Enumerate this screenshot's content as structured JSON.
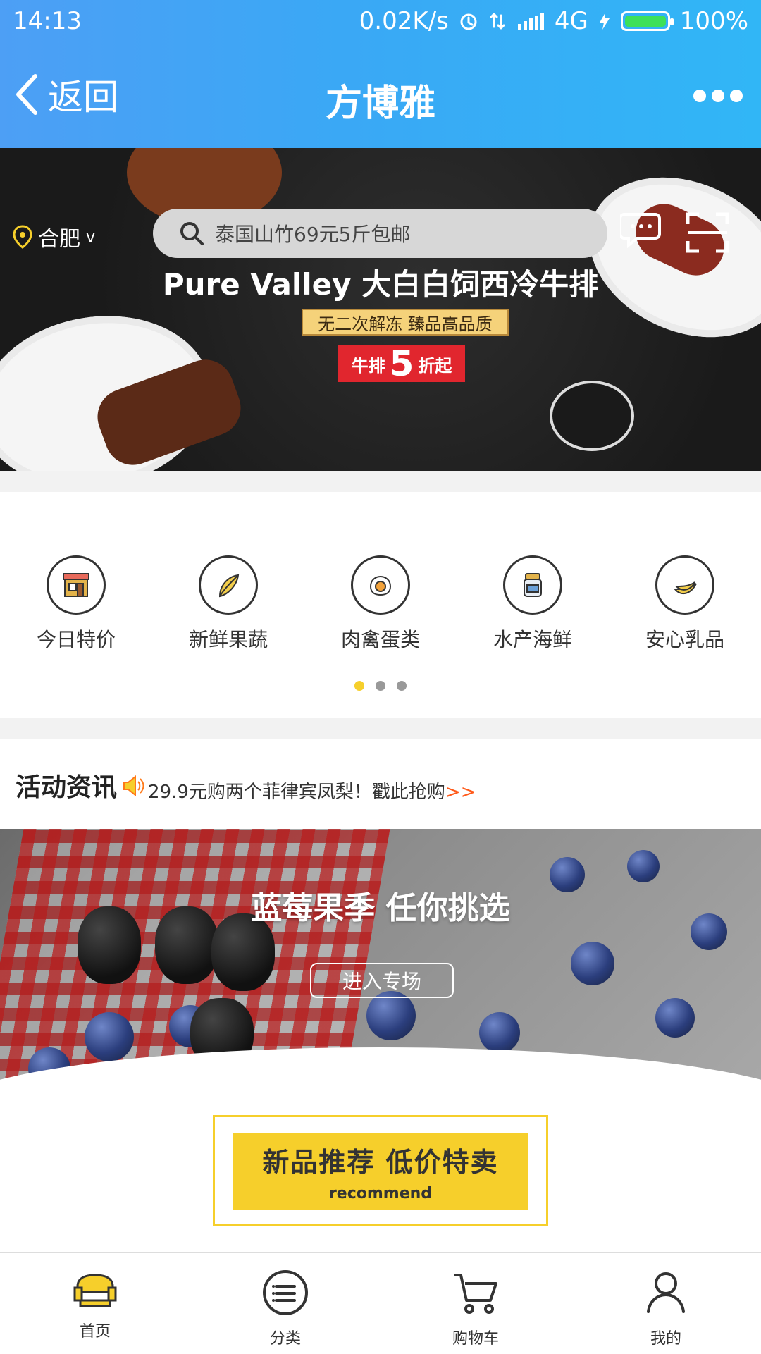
{
  "status_bar": {
    "time": "14:13",
    "network_speed": "0.02K/s",
    "network": "4G",
    "battery": "100%",
    "battery_level": 1.0
  },
  "header": {
    "back_label": "返回",
    "title": "方博雅",
    "more_icon": "more-dots-icon"
  },
  "banner": {
    "location": "合肥",
    "location_chevron": "v",
    "search_placeholder": "泰国山竹69元5斤包邮",
    "headline": "Pure Valley 大白白饲西冷牛排",
    "subline": "无二次解冻 臻品高品质",
    "badge_prefix": "牛排",
    "badge_number": "5",
    "badge_suffix": "折起"
  },
  "categories": {
    "items": [
      {
        "label": "今日特价",
        "icon": "shop-icon"
      },
      {
        "label": "新鲜果蔬",
        "icon": "vegetable-icon"
      },
      {
        "label": "肉禽蛋类",
        "icon": "egg-icon"
      },
      {
        "label": "水产海鲜",
        "icon": "jar-icon"
      },
      {
        "label": "安心乳品",
        "icon": "banana-icon"
      }
    ],
    "page_count": 3,
    "active_page": 1
  },
  "activity": {
    "title": "活动资讯",
    "text": "29.9元购两个菲律宾凤梨！戳此抢购",
    "arrow": ">>"
  },
  "promo": {
    "title": "蓝莓果季  任你挑选",
    "button_label": "进入专场"
  },
  "recommend": {
    "main": "新品推荐    低价特卖",
    "sub": "recommend"
  },
  "tabbar": {
    "items": [
      {
        "label": "首页",
        "icon": "home-sofa-icon"
      },
      {
        "label": "分类",
        "icon": "category-list-icon"
      },
      {
        "label": "购物车",
        "icon": "cart-icon"
      },
      {
        "label": "我的",
        "icon": "user-icon"
      }
    ]
  }
}
